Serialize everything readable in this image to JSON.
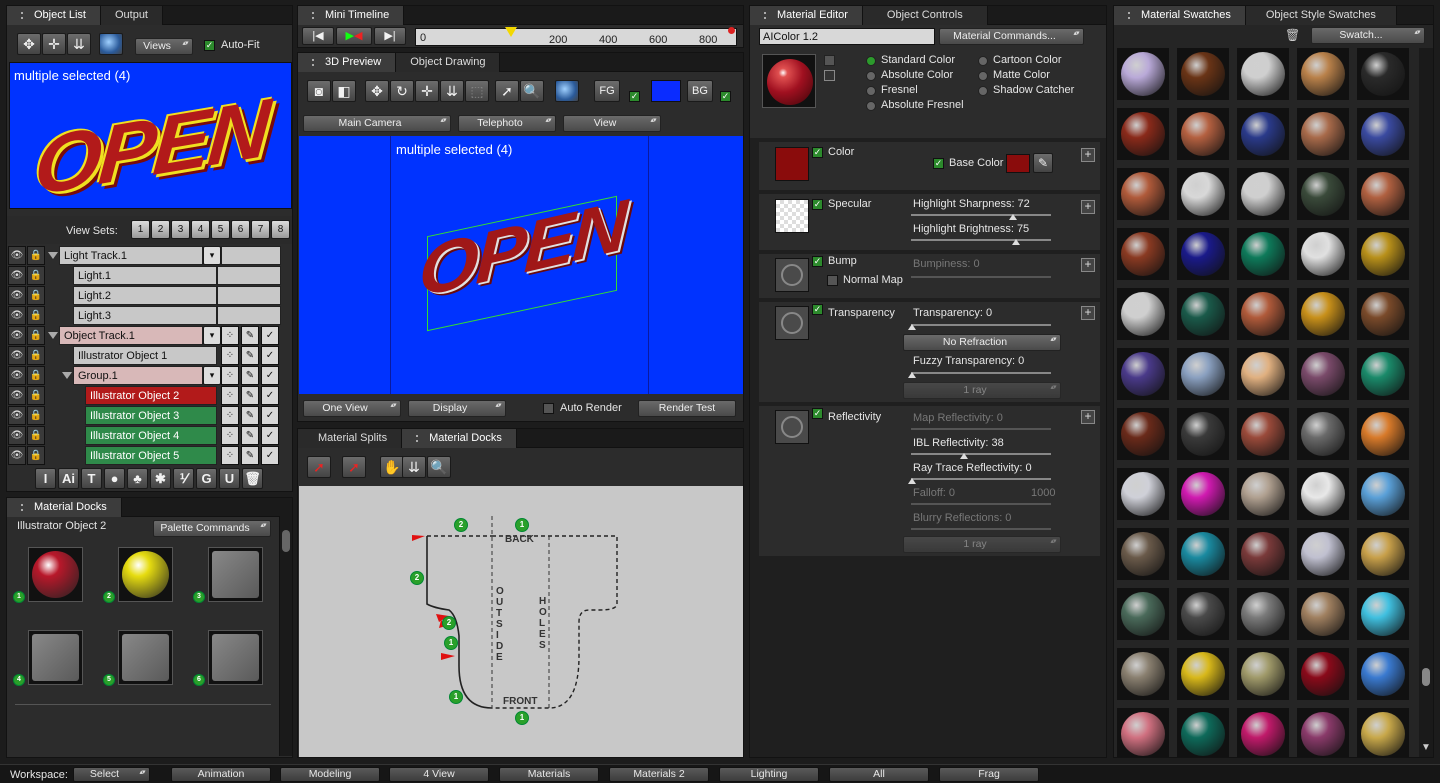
{
  "object_list_panel": {
    "tabs": [
      "Object List",
      "Output"
    ],
    "views_label": "Views",
    "autofit_label": "Auto-Fit",
    "preview_text": "multiple selected (4)",
    "preview_graphic_text": "OPEN",
    "view_sets_label": "View Sets:",
    "view_set_numbers": [
      "1",
      "2",
      "3",
      "4",
      "5",
      "6",
      "7",
      "8"
    ],
    "tracks": [
      {
        "label": "Light Track.1",
        "style": "track"
      },
      {
        "label": "Light.1",
        "style": "item"
      },
      {
        "label": "Light.2",
        "style": "item"
      },
      {
        "label": "Light.3",
        "style": "item"
      },
      {
        "label": "Object Track.1",
        "style": "objtrack"
      },
      {
        "label": "Illustrator Object 1",
        "style": "item"
      },
      {
        "label": "Group.1",
        "style": "objtrack"
      },
      {
        "label": "Illustrator Object 2",
        "style": "red"
      },
      {
        "label": "Illustrator Object 3",
        "style": "green"
      },
      {
        "label": "Illustrator Object 4",
        "style": "green"
      },
      {
        "label": "Illustrator Object 5",
        "style": "green"
      }
    ],
    "bottom_tools": [
      "I",
      "Ai",
      "T",
      "●",
      "♣",
      "✱",
      "⅟",
      "G",
      "U",
      "🗑"
    ]
  },
  "material_docks_left": {
    "tab": "Material Docks",
    "object_label": "Illustrator Object 2",
    "palette_commands": "Palette Commands",
    "docks": [
      {
        "number": "1",
        "color": "#b8182a"
      },
      {
        "number": "2",
        "color": "#e6dc10"
      },
      {
        "number": "3",
        "color": "#777777"
      },
      {
        "number": "4",
        "color": "#777777"
      },
      {
        "number": "5",
        "color": "#777777"
      },
      {
        "number": "6",
        "color": "#777777"
      }
    ]
  },
  "mini_timeline": {
    "tab": "Mini Timeline",
    "frame_value": "0",
    "ticks": [
      "200",
      "400",
      "600",
      "800"
    ]
  },
  "preview_panel": {
    "tabs": [
      "3D Preview",
      "Object Drawing"
    ],
    "fg_label": "FG",
    "bg_label": "BG",
    "camera_menu": "Main Camera",
    "lens_menu": "Telephoto",
    "view_menu": "View",
    "viewport_text": "multiple selected (4)",
    "graphic_text": "OPEN",
    "one_view": "One View",
    "display": "Display",
    "auto_render": "Auto Render",
    "render_test": "Render Test"
  },
  "material_splits_panel": {
    "tabs": [
      "Material Splits",
      "Material Docks"
    ],
    "labels": {
      "back": "BACK",
      "front": "FRONT",
      "outside": "OUTSIDE",
      "holes": "HOLES"
    },
    "markers": [
      "2",
      "1",
      "2",
      "2",
      "1",
      "1",
      "1"
    ]
  },
  "material_editor": {
    "tabs": [
      "Material Editor",
      "Object Controls"
    ],
    "material_name": "AIColor 1.2",
    "material_commands": "Material Commands...",
    "modes": [
      "Standard Color",
      "Absolute Color",
      "Fresnel",
      "Absolute Fresnel",
      "Cartoon Color",
      "Matte Color",
      "Shadow Catcher"
    ],
    "selected_mode": "Standard Color",
    "color_label": "Color",
    "base_color_label": "Base Color",
    "base_color": "#8a0c0c",
    "specular_label": "Specular",
    "highlight_sharpness": "Highlight Sharpness: 72",
    "highlight_sharpness_value": 72,
    "highlight_brightness": "Highlight Brightness: 75",
    "highlight_brightness_value": 75,
    "bump_label": "Bump",
    "bumpiness": "Bumpiness: 0",
    "normal_map": "Normal Map",
    "transparency_label": "Transparency",
    "transparency": "Transparency: 0",
    "no_refraction": "No Refraction",
    "fuzzy_transparency": "Fuzzy Transparency: 0",
    "ray_label": "1 ray",
    "reflectivity_label": "Reflectivity",
    "map_reflectivity": "Map Reflectivity: 0",
    "ibl_reflectivity": "IBL Reflectivity: 38",
    "ibl_reflectivity_value": 38,
    "ray_trace_reflectivity": "Ray Trace Reflectivity: 0",
    "falloff": "Falloff: 0",
    "falloff_max": "1000",
    "blurry_reflections": "Blurry Reflections: 0"
  },
  "swatches_panel": {
    "tabs": [
      "Material Swatches",
      "Object Style Swatches"
    ],
    "swatch_menu": "Swatch...",
    "swatch_colors": [
      [
        "#b9a9d8",
        "#6a3416",
        "#cfcfcf",
        "#b9814a",
        "#2a2a2a"
      ],
      [
        "#8a2a1a",
        "#b46040",
        "#2a3a8a",
        "#a86a4a",
        "#3a4aa0"
      ],
      [
        "#b05a3a",
        "#d8d8d8",
        "#cfcfcf",
        "#3a4a3a",
        "#b06040"
      ],
      [
        "#8a3a22",
        "#1a1a8a",
        "#0e7a5a",
        "#e0e0e0",
        "#b8901a"
      ],
      [
        "#cfcfcf",
        "#1a5a4a",
        "#b05a3a",
        "#c8901a",
        "#7a4a2a"
      ],
      [
        "#4a3a8a",
        "#8aa0c0",
        "#e0b080",
        "#7a4a6a",
        "#1a8a6a"
      ],
      [
        "#6a2a1a",
        "#3a3a3a",
        "#9a4a3a",
        "#6a6a6a",
        "#d87a2a"
      ],
      [
        "#cfd0d8",
        "#d01ab0",
        "#b0a090",
        "#e8e8e8",
        "#5aa0d8"
      ],
      [
        "#6a5a4a",
        "#1a8aa0",
        "#7a3a3a",
        "#c0c0d0",
        "#c8a04a"
      ],
      [
        "#4a6a5a",
        "#4a4a4a",
        "#7a7a7a",
        "#a08060",
        "#40c0e0"
      ],
      [
        "#8a8070",
        "#d8b81a",
        "#a09a6a",
        "#8a0a1a",
        "#3a7ad0"
      ],
      [
        "#d07080",
        "#0e6a5a",
        "#c01a6a",
        "#8a3a6a",
        "#c8a84a"
      ]
    ]
  },
  "workspace_bar": {
    "label": "Workspace:",
    "current": "Select",
    "buttons": [
      "Animation",
      "Modeling",
      "4 View",
      "Materials",
      "Materials 2",
      "Lighting",
      "All",
      "Frag"
    ]
  }
}
